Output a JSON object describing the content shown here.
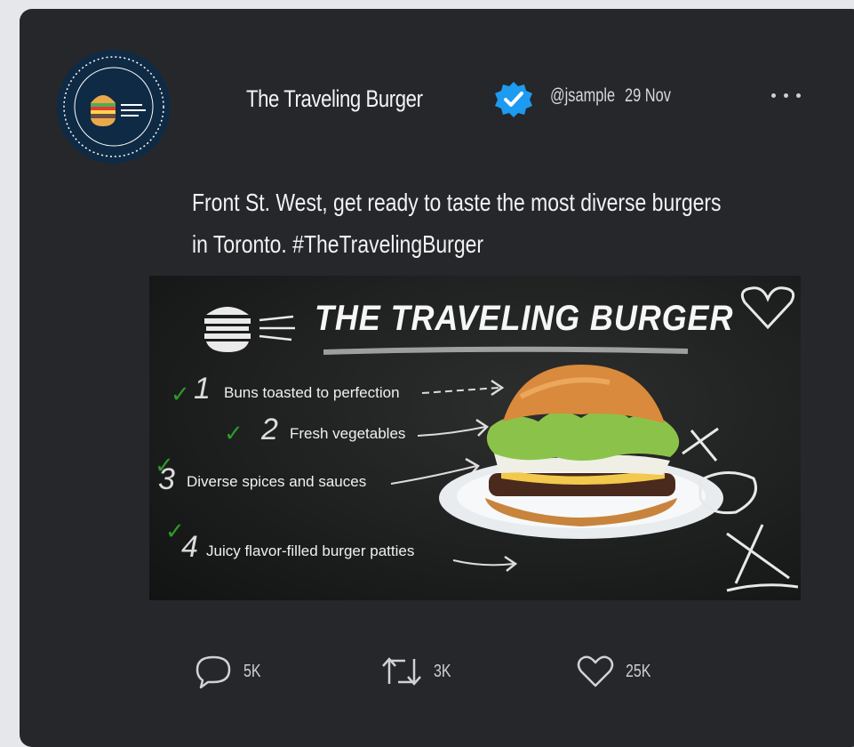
{
  "account": {
    "name": "The Traveling Burger",
    "handle": "@jsample",
    "date": "29 Nov",
    "verified": true
  },
  "tweet": {
    "text_line1": "Front St. West, get ready to taste the most diverse burgers",
    "text_line2": "in Toronto. #TheTravelingBurger"
  },
  "media": {
    "title": "THE TRAVELING BURGER",
    "items": [
      {
        "number": "1",
        "text": "Buns toasted to perfection"
      },
      {
        "number": "2",
        "text": "Fresh vegetables"
      },
      {
        "number": "3",
        "text": "Diverse spices and sauces"
      },
      {
        "number": "4",
        "text": "Juicy flavor-filled burger patties"
      }
    ]
  },
  "actions": {
    "reply_count": "5K",
    "retweet_count": "3K",
    "like_count": "25K"
  },
  "colors": {
    "card_bg": "#26272b",
    "page_bg": "#e6e7eb",
    "verified": "#1d9bf0",
    "check": "#2e9a2a"
  },
  "icons": [
    "reply-icon",
    "retweet-icon",
    "like-icon",
    "verified-badge-icon",
    "more-icon"
  ]
}
